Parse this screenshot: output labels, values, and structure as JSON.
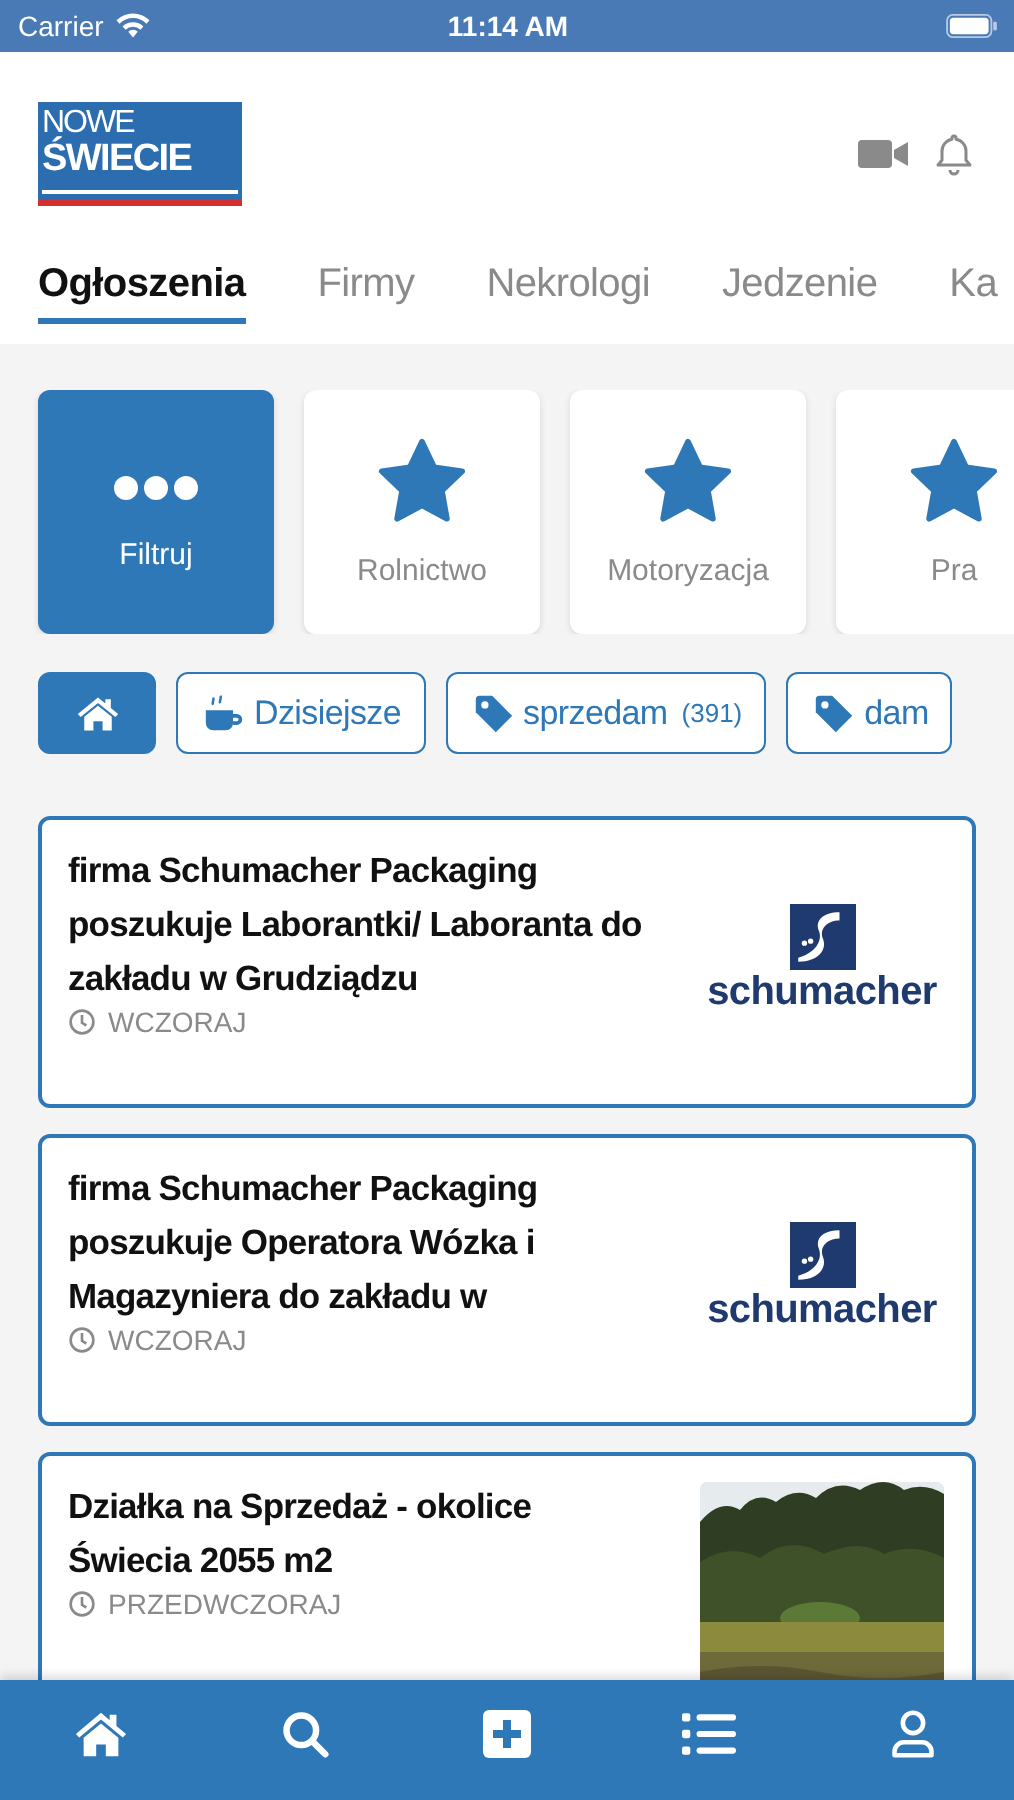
{
  "status_bar": {
    "carrier": "Carrier",
    "time": "11:14 AM"
  },
  "header": {
    "logo": {
      "line1": "NOWE",
      "line2": "ŚWIECIE"
    }
  },
  "tabs": [
    {
      "label": "Ogłoszenia",
      "selected": true
    },
    {
      "label": "Firmy",
      "selected": false
    },
    {
      "label": "Nekrologi",
      "selected": false
    },
    {
      "label": "Jedzenie",
      "selected": false
    },
    {
      "label": "Ka",
      "selected": false
    }
  ],
  "categories": [
    {
      "kind": "filter",
      "label": "Filtruj"
    },
    {
      "kind": "star",
      "label": "Rolnictwo"
    },
    {
      "kind": "star",
      "label": "Motoryzacja"
    },
    {
      "kind": "star",
      "label": "Pra"
    }
  ],
  "chips": [
    {
      "kind": "home"
    },
    {
      "kind": "coffee",
      "label": "Dzisiejsze"
    },
    {
      "kind": "tag",
      "label": "sprzedam",
      "count": "(391)"
    },
    {
      "kind": "tag",
      "label": "dam"
    }
  ],
  "listings": [
    {
      "title": "firma Schumacher Packaging poszukuje Laborantki/ Laboranta do zakładu w Grudziądzu",
      "time": "WCZORAJ",
      "thumb": {
        "kind": "logo",
        "text": "schumacher"
      }
    },
    {
      "title": "firma Schumacher Packaging poszukuje Operatora Wózka i Magazyniera do zakładu w",
      "time": "WCZORAJ",
      "thumb": {
        "kind": "logo",
        "text": "schumacher"
      }
    },
    {
      "title": "Działka na Sprzedaż - okolice Świecia 2055 m2",
      "time": "PRZEDWCZORAJ"
    }
  ],
  "bottom_nav": [
    {
      "kind": "home"
    },
    {
      "kind": "search"
    },
    {
      "kind": "add"
    },
    {
      "kind": "list"
    },
    {
      "kind": "profile"
    }
  ]
}
